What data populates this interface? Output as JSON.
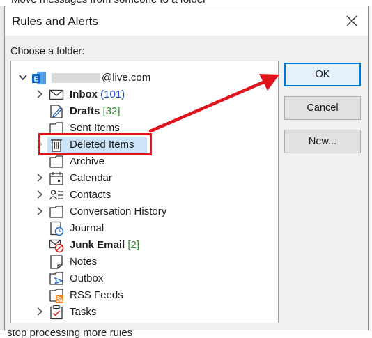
{
  "background": {
    "top_text": "Move messages from someone to a folder",
    "bottom_text": "stop processing more rules"
  },
  "dialog": {
    "title": "Rules and Alerts",
    "choose_label": "Choose a folder:",
    "account": {
      "email_masked": "@live.com",
      "icon": "exchange-account-icon"
    },
    "folders": [
      {
        "name": "Inbox",
        "count": "(101)",
        "bold": true,
        "count_style": "blue",
        "icon": "inbox-icon",
        "expandable": true
      },
      {
        "name": "Drafts",
        "count": "[32]",
        "bold": true,
        "count_style": "green",
        "icon": "drafts-icon",
        "expandable": false
      },
      {
        "name": "Sent Items",
        "count": "",
        "bold": false,
        "icon": "folder-icon",
        "expandable": false
      },
      {
        "name": "Deleted Items",
        "count": "",
        "bold": false,
        "icon": "trash-icon",
        "expandable": true,
        "selected": true
      },
      {
        "name": "Archive",
        "count": "",
        "bold": false,
        "icon": "folder-icon",
        "expandable": false
      },
      {
        "name": "Calendar",
        "count": "",
        "bold": false,
        "icon": "calendar-icon",
        "expandable": true
      },
      {
        "name": "Contacts",
        "count": "",
        "bold": false,
        "icon": "contacts-icon",
        "expandable": true
      },
      {
        "name": "Conversation History",
        "count": "",
        "bold": false,
        "icon": "folder-icon",
        "expandable": true
      },
      {
        "name": "Journal",
        "count": "",
        "bold": false,
        "icon": "journal-icon",
        "expandable": false
      },
      {
        "name": "Junk Email",
        "count": "[2]",
        "bold": true,
        "count_style": "green",
        "icon": "junk-icon",
        "expandable": false
      },
      {
        "name": "Notes",
        "count": "",
        "bold": false,
        "icon": "notes-icon",
        "expandable": false
      },
      {
        "name": "Outbox",
        "count": "",
        "bold": false,
        "icon": "outbox-icon",
        "expandable": false
      },
      {
        "name": "RSS Feeds",
        "count": "",
        "bold": false,
        "icon": "rss-icon",
        "expandable": false
      },
      {
        "name": "Tasks",
        "count": "",
        "bold": false,
        "icon": "tasks-icon",
        "expandable": true
      }
    ],
    "buttons": {
      "ok": "OK",
      "cancel": "Cancel",
      "new": "New..."
    }
  },
  "annotations": {
    "highlight_color": "#e0141c",
    "arrow_color": "#e0141c"
  },
  "colors": {
    "selection": "#cce4f7",
    "accent": "#0078d7",
    "count_blue": "#1e4fc8",
    "count_green": "#2e8b2e"
  }
}
